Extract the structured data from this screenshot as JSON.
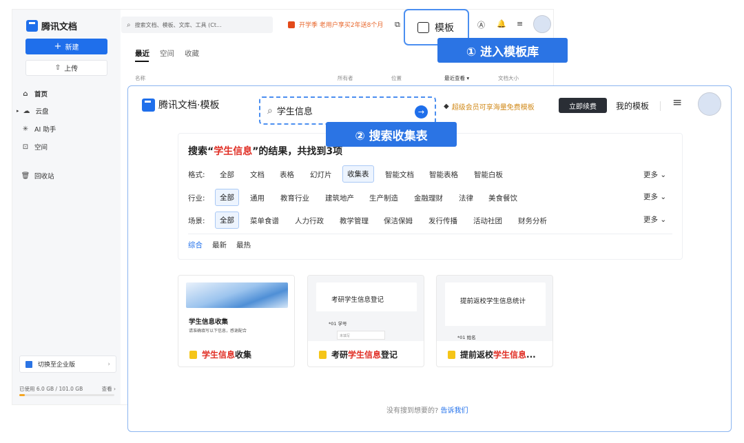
{
  "app": {
    "logo_text": "腾讯文档",
    "new_button": "新建",
    "upload_button": "上传",
    "nav": [
      {
        "label": "首页",
        "icon": "home-icon"
      },
      {
        "label": "云盘",
        "icon": "cloud-icon"
      },
      {
        "label": "AI 助手",
        "icon": "ai-spark-icon"
      },
      {
        "label": "空间",
        "icon": "space-icon"
      },
      {
        "label": "回收站",
        "icon": "trash-icon"
      }
    ],
    "enterprise_switch": "切换至企业版",
    "storage_used": "已使用 6.0 GB / 101.0 GB",
    "storage_view": "查看 ›",
    "storage_fraction": 0.06,
    "search_placeholder": "搜索文档、模板、文库、工具 (Ct...",
    "promo": "开学季 老用户享买2年送8个月",
    "template_button": "模板",
    "tabs": [
      "最近",
      "空间",
      "收藏"
    ],
    "columns": [
      "名称",
      "所有者",
      "位置",
      "最近查看",
      "文档大小"
    ]
  },
  "callouts": {
    "step1": "① 进入模板库",
    "step2": "② 搜索收集表"
  },
  "panel": {
    "logo_text": "腾讯文档·模板",
    "search_value": "学生信息",
    "vip_text": "超级会员可享海量免费模板",
    "renew_button": "立即续费",
    "my_templates": "我的模板",
    "result_prefix": "搜索“",
    "result_keyword": "学生信息",
    "result_suffix": "”的结果，共找到3项",
    "filters": {
      "format": {
        "label": "格式:",
        "options": [
          "全部",
          "文档",
          "表格",
          "幻灯片",
          "收集表",
          "智能文档",
          "智能表格",
          "智能白板"
        ],
        "selected": "收集表"
      },
      "industry": {
        "label": "行业:",
        "options": [
          "全部",
          "通用",
          "教育行业",
          "建筑地产",
          "生产制造",
          "金融理财",
          "法律",
          "美食餐饮"
        ],
        "selected": "全部"
      },
      "scene": {
        "label": "场景:",
        "options": [
          "全部",
          "菜单食谱",
          "人力行政",
          "教学管理",
          "保洁保姆",
          "发行传播",
          "活动社团",
          "财务分析"
        ],
        "selected": "全部"
      }
    },
    "more_label": "更多",
    "sort": [
      "综合",
      "最新",
      "最热"
    ],
    "cards": [
      {
        "thumb_title": "学生信息收集",
        "thumb_sub": "请准确填写以下信息，感谢配合",
        "name_prefix": "",
        "name_kw": "学生信息",
        "name_suffix": "收集"
      },
      {
        "thumb_title": "考研学生信息登记",
        "thumb_sub": "*01 学号",
        "thumb_input": "未填写",
        "name_prefix": "考研",
        "name_kw": "学生信息",
        "name_suffix": "登记"
      },
      {
        "thumb_title": "提前返校学生信息统计",
        "thumb_sub": "*01 姓名",
        "name_prefix": "提前返校",
        "name_kw": "学生信息",
        "name_suffix": "..."
      }
    ],
    "footer_text": "没有搜到想要的?",
    "footer_link": "告诉我们"
  }
}
